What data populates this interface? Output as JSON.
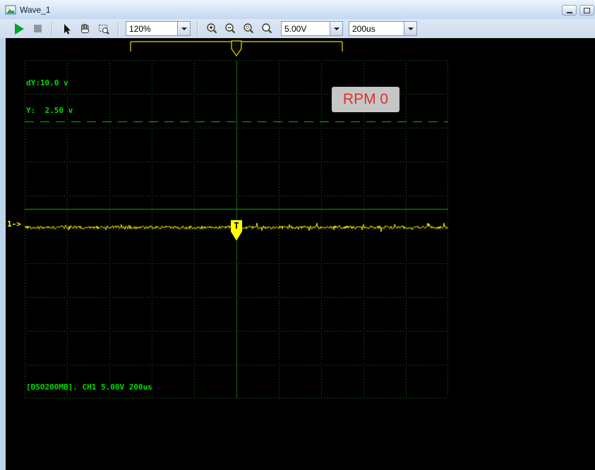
{
  "window": {
    "title": "Wave_1"
  },
  "toolbar": {
    "zoom_value": "120%",
    "volts_per_div": "5.00V",
    "time_per_div": "200us",
    "icons": [
      "play",
      "stop",
      "select-arrow",
      "pan-hand",
      "zoom-window",
      "zoom-in",
      "zoom-out",
      "zoom-region",
      "zoom-reset"
    ]
  },
  "scope": {
    "dy_readout": "dY:10.0 v",
    "y_readout": "Y:  2.50 v",
    "rpm_label": "RPM 0",
    "channel_marker": "1->",
    "trigger_glyph": "T",
    "status_line": "[DSO200MB]. CH1 5.00V 200us"
  },
  "scope_render": {
    "grid_cols": 10,
    "grid_rows": 10,
    "grid_color": "#1e7a1e",
    "center_line_color": "#1b6e1b",
    "dashed_cursor_frac": 0.18125,
    "dashed_cursor_color": "#00c800",
    "solid_cursor_frac": 0.4396,
    "solid_cursor_color": "#00b400",
    "trace_frac": 0.494,
    "trace_color": "#ffff00",
    "trigger_frac": 0.5,
    "noise_amp": 2.2,
    "spike_amp": 5,
    "seed": 987654321
  },
  "colors": {
    "scope_text_green": "#00dc00",
    "trace_yellow": "#ffff00",
    "rpm_text": "#e03030",
    "rpm_bg": "#c6c6c6",
    "ruler_yellow": "#b8b800"
  }
}
